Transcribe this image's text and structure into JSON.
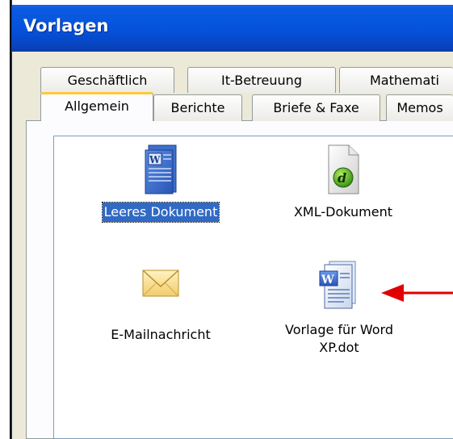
{
  "window": {
    "title": "Vorlagen"
  },
  "tabs_back": [
    "Geschäftlich",
    "It-Betreuung",
    "Mathemati"
  ],
  "tabs_front": [
    "Allgemein",
    "Berichte",
    "Briefe & Faxe",
    "Memos"
  ],
  "active_tab": "Allgemein",
  "items": [
    {
      "label": "Leeres Dokument",
      "icon": "word-document-icon",
      "selected": true
    },
    {
      "label": "XML-Dokument",
      "icon": "xml-document-icon",
      "selected": false
    },
    {
      "label": "E-Mailnachricht",
      "icon": "envelope-icon",
      "selected": false
    },
    {
      "label_line1": "Vorlage für Word",
      "label_line2": "XP.dot",
      "icon": "word-template-icon",
      "selected": false
    }
  ],
  "colors": {
    "titlebar": "#0553DD",
    "selection": "#316AC5",
    "active_tab_accent": "#FFC83C",
    "arrow": "#E00000"
  }
}
